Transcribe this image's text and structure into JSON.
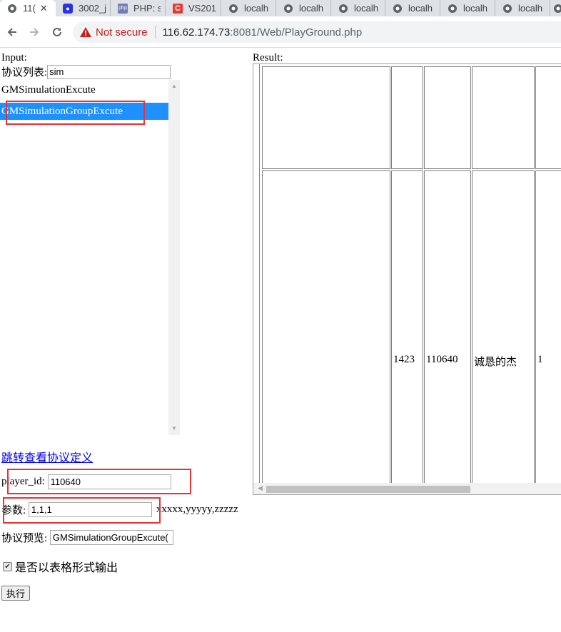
{
  "browser": {
    "tabs": [
      {
        "label": "11(",
        "icon": "globe-icon",
        "active": true,
        "closable": true
      },
      {
        "label": "3002_j",
        "icon": "baidu-paw-icon"
      },
      {
        "label": "PHP: s",
        "icon": "php-icon"
      },
      {
        "label": "VS201",
        "icon": "csdn-icon"
      },
      {
        "label": "localh",
        "icon": "globe-icon"
      },
      {
        "label": "localh",
        "icon": "globe-icon"
      },
      {
        "label": "localh",
        "icon": "globe-icon"
      },
      {
        "label": "localh",
        "icon": "globe-icon"
      },
      {
        "label": "localh",
        "icon": "globe-icon"
      },
      {
        "label": "localh",
        "icon": "globe-icon"
      },
      {
        "label": "",
        "icon": "globe-icon"
      }
    ],
    "security_label": "Not secure",
    "url_host": "116.62.174.73",
    "url_rest": ":8081/Web/PlayGround.php",
    "warning_color": "#c5221f"
  },
  "left": {
    "input_label": "Input:",
    "filter_label": "协议列表:",
    "filter_value": "sim",
    "protocols": [
      {
        "label": "GMSimulationExcute",
        "selected": false
      },
      {
        "label": "GMSimulationGroupExcute",
        "selected": true
      }
    ],
    "link_text": "跳转查看协议定义",
    "player_id_label": "player_id:",
    "player_id_value": "110640",
    "params_label": "参数:",
    "params_value": "1,1,1",
    "params_hint": "xxxxx,yyyyy,zzzzz",
    "preview_label": "协议预览:",
    "preview_value": "GMSimulationGroupExcute(",
    "table_output_label": "是否以表格形式输出",
    "table_output_checked": true,
    "execute_label": "执行",
    "selected_color": "#1e90ff",
    "highlight_color": "#e0353a"
  },
  "result": {
    "label": "Result:",
    "row2": [
      "1423",
      "110640",
      "诚恳的杰",
      "1"
    ]
  }
}
